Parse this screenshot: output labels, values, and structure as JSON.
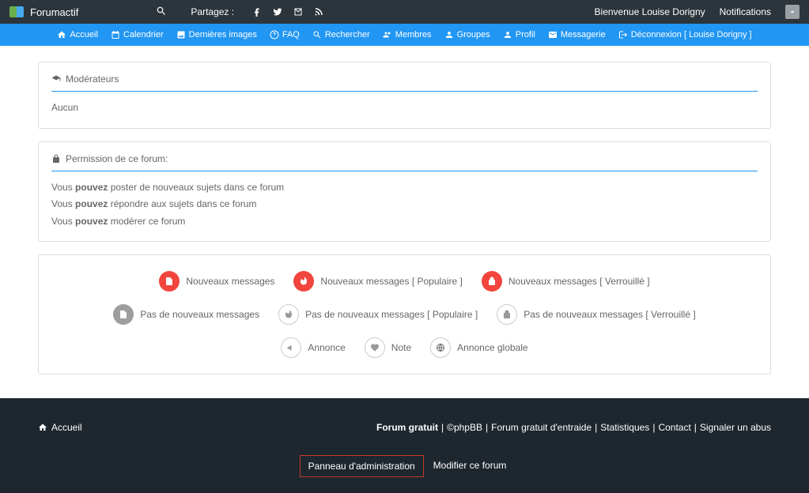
{
  "topbar": {
    "brand": "Forumactif",
    "share_label": "Partagez :",
    "welcome": "Bienvenue Louise Dorigny",
    "notifications": "Notifications"
  },
  "nav": {
    "home": "Accueil",
    "calendar": "Calendrier",
    "images": "Dernières images",
    "faq": "FAQ",
    "search": "Rechercher",
    "members": "Membres",
    "groups": "Groupes",
    "profile": "Profil",
    "messaging": "Messagerie",
    "logout": "Déconnexion [ Louise Dorigny ]"
  },
  "moderators": {
    "title": "Modérateurs",
    "content": "Aucun"
  },
  "permissions": {
    "title": "Permission de ce forum:",
    "line1_pre": "Vous ",
    "line1_strong": "pouvez",
    "line1_post": " poster de nouveaux sujets dans ce forum",
    "line2_pre": "Vous ",
    "line2_strong": "pouvez",
    "line2_post": " répondre aux sujets dans ce forum",
    "line3_pre": "Vous ",
    "line3_strong": "pouvez",
    "line3_post": " modérer ce forum"
  },
  "legend": {
    "new": "Nouveaux messages",
    "new_popular": "Nouveaux messages [ Populaire ]",
    "new_locked": "Nouveaux messages [ Verrouillé ]",
    "no_new": "Pas de nouveaux messages",
    "no_new_popular": "Pas de nouveaux messages [ Populaire ]",
    "no_new_locked": "Pas de nouveaux messages [ Verrouillé ]",
    "announce": "Annonce",
    "note": "Note",
    "global": "Annonce globale"
  },
  "footer": {
    "home": "Accueil",
    "forum_free": "Forum gratuit",
    "phpbb": "©phpBB",
    "help": "Forum gratuit d'entraide",
    "stats": "Statistiques",
    "contact": "Contact",
    "report": "Signaler un abus",
    "admin_panel": "Panneau d'administration",
    "modify": "Modifier ce forum"
  }
}
